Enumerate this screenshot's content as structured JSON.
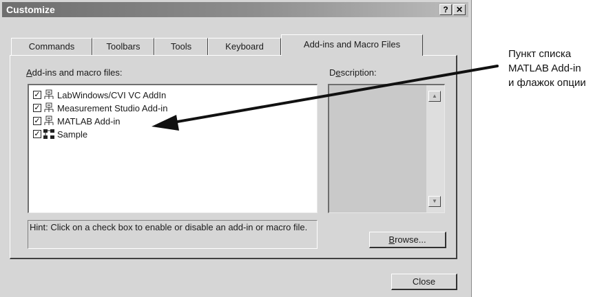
{
  "window": {
    "title": "Customize",
    "help_label": "?",
    "close_label": "✕"
  },
  "tabs": [
    {
      "label": "Commands"
    },
    {
      "label": "Toolbars"
    },
    {
      "label": "Tools"
    },
    {
      "label": "Keyboard"
    },
    {
      "label": "Add-ins and Macro Files",
      "active": true
    }
  ],
  "addins": {
    "label_mnemonic": "A",
    "label_rest": "dd-ins and macro files:",
    "items": [
      {
        "label": "LabWindows/CVI VC AddIn",
        "checked": true,
        "icon": "addin-icon"
      },
      {
        "label": "Measurement Studio Add-in",
        "checked": true,
        "icon": "addin-icon"
      },
      {
        "label": "MATLAB Add-in",
        "checked": true,
        "icon": "addin-icon"
      },
      {
        "label": "Sample",
        "checked": true,
        "icon": "macro-icon"
      }
    ]
  },
  "description": {
    "label_pre": "D",
    "label_mnemonic": "e",
    "label_rest": "scription:"
  },
  "hint": {
    "text": "Hint: Click on a check box to enable or disable an add-in or macro file."
  },
  "buttons": {
    "browse_mnemonic": "B",
    "browse_rest": "rowse...",
    "close": "Close"
  },
  "annotation": {
    "lines": [
      "Пункт списка",
      "MATLAB Add-in",
      "и флажок опции"
    ]
  },
  "colors": {
    "dialog_bg": "#d6d6d6",
    "title_gradient_start": "#6e6e6e",
    "title_gradient_end": "#bdbdbd"
  }
}
